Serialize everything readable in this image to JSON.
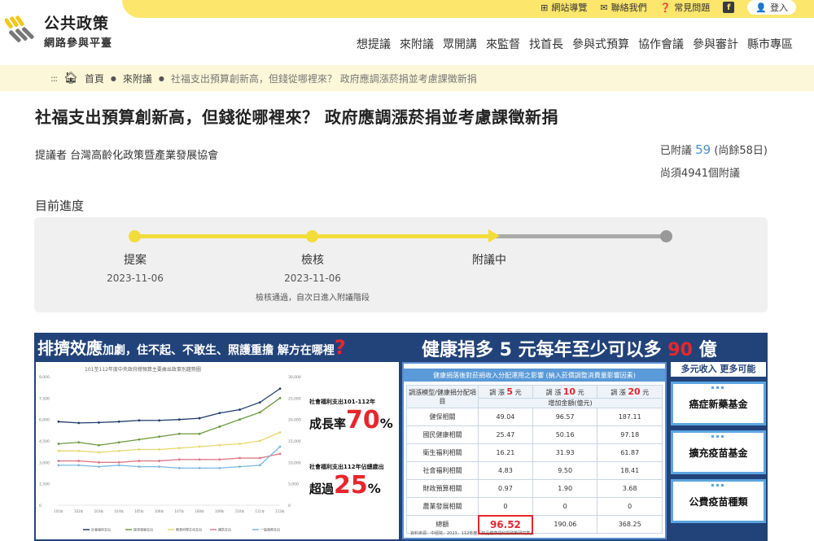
{
  "header": {
    "logo_line1": "公共政策",
    "logo_line2": "網路參與平臺",
    "util": [
      {
        "icon": "sitemap-icon",
        "label": "網站導覽"
      },
      {
        "icon": "mail-icon",
        "label": "聯絡我們"
      },
      {
        "icon": "help-circle-icon",
        "label": "常見問題"
      }
    ],
    "facebook": "f",
    "login": "登入",
    "nav": [
      "想提議",
      "來附議",
      "眾開講",
      "來監督",
      "找首長",
      "參與式預算",
      "協作會議",
      "參與審計",
      "縣市專區"
    ]
  },
  "breadcrumb": {
    "dots": ":::",
    "home": "首頁",
    "section": "來附議",
    "current": "社福支出預算創新高，但錢從哪裡來？ 政府應調漲菸捐並考慮課徵新捐"
  },
  "proposal": {
    "title": "社福支出預算創新高，但錢從哪裡來？ 政府應調漲菸捐並考慮課徵新捐",
    "proposer_label": "提議者",
    "proposer": "台灣高齡化政策暨產業發展協會",
    "seconded_label": "已附議",
    "seconded_count": "59",
    "days_left": "(尚餘58日)",
    "needed": "尚須4941個附議"
  },
  "progress": {
    "label": "目前進度",
    "stages": [
      {
        "name": "提案",
        "date": "2023-11-06",
        "note": ""
      },
      {
        "name": "檢核",
        "date": "2023-11-06",
        "note": "檢核通過，自次日進入附議階段"
      },
      {
        "name": "附議中",
        "date": "",
        "note": ""
      }
    ]
  },
  "banner": {
    "left_title_a": "排擠效應",
    "left_title_b": "加劇",
    "left_title_c": "，住不起、不敢生、照護重擔  解方在哪裡",
    "left_q": "?",
    "right_title_a": "健康捐多 5 元每年至少可以多 ",
    "right_title_num": "90",
    "right_title_b": " 億",
    "chart_title": "101至112年度中央政府總預算主要歲出政事別趨勢圖",
    "stat1_small": "社會福利支出101-112年",
    "stat1_label": "成長率",
    "stat1_value": "70",
    "stat1_unit": "%",
    "stat2_small": "社會福利支出112年佔總歲出",
    "stat2_label": "超過",
    "stat2_value": "25",
    "stat2_unit": "%",
    "table_title": "健康捐落後對菸捐收入分配運用之影響 (納入菸價調整消費量影響因素)",
    "table_head_col1": "調漲模型/健康捐分配項目",
    "table_head_prefix": "調 漲",
    "table_head_vals": [
      "5",
      "10",
      "20"
    ],
    "table_head_suffix": "元",
    "table_subhead": "增加金額(億元)",
    "rows": [
      {
        "label": "健保相關",
        "v": [
          "49.04",
          "96.57",
          "187.11"
        ]
      },
      {
        "label": "國民健康相關",
        "v": [
          "25.47",
          "50.16",
          "97.18"
        ]
      },
      {
        "label": "衛生福利相關",
        "v": [
          "16.21",
          "31.93",
          "61.87"
        ]
      },
      {
        "label": "社會福利相關",
        "v": [
          "4.83",
          "9.50",
          "18.41"
        ]
      },
      {
        "label": "財政預算相關",
        "v": [
          "0.97",
          "1.90",
          "3.68"
        ]
      },
      {
        "label": "農業發展相關",
        "v": [
          "0",
          "0",
          "0"
        ]
      },
      {
        "label": "總額",
        "v": [
          "96.52",
          "190.06",
          "368.25"
        ]
      }
    ],
    "source": "資料來源：中經院，2023，112年度「菸品健康福利捐政策研究案」。",
    "side_head": "多元收入 更多可能",
    "side_items": [
      "癌症新藥基金",
      "擴充疫苗基金",
      "公費疫苗種類"
    ]
  },
  "chart_data": {
    "type": "line",
    "title": "101至112年度中央政府總預算主要歲出政事別趨勢圖",
    "x": [
      "101年",
      "102年",
      "103年",
      "104年",
      "105年",
      "106年",
      "107年",
      "108年",
      "109年",
      "110年",
      "111年",
      "112年"
    ],
    "ylim": [
      0,
      9000
    ],
    "y2lim": [
      0,
      30000
    ],
    "series": [
      {
        "name": "社會福利支出",
        "axis": "right",
        "color": "#1f3d6b",
        "values": [
          19500,
          19200,
          19300,
          19500,
          19800,
          19800,
          20000,
          20300,
          21500,
          22300,
          24000,
          27200
        ]
      },
      {
        "name": "經濟發展支出",
        "axis": "left",
        "color": "#6a9a3a",
        "values": [
          4300,
          4400,
          4200,
          4400,
          4600,
          4800,
          5000,
          5000,
          5500,
          6000,
          6500,
          7500
        ]
      },
      {
        "name": "教育科學文化支出",
        "axis": "left",
        "color": "#e8d86a",
        "values": [
          3800,
          3800,
          3700,
          3800,
          3900,
          3900,
          4000,
          4100,
          4200,
          4300,
          4500,
          5100
        ]
      },
      {
        "name": "國防支出",
        "axis": "left",
        "color": "#e07a8a",
        "values": [
          3100,
          3100,
          3000,
          3000,
          3100,
          3100,
          3200,
          3200,
          3200,
          3300,
          3300,
          3600
        ]
      },
      {
        "name": "一般政務支出",
        "axis": "left",
        "color": "#7ab8e0",
        "values": [
          2800,
          2800,
          2700,
          2800,
          2700,
          2700,
          2600,
          2600,
          2600,
          2700,
          2800,
          4100
        ]
      }
    ],
    "yticks": [
      "0",
      "1,500",
      "3,000",
      "4,500",
      "6,000",
      "7,500",
      "9,000"
    ],
    "y2ticks": [
      "0",
      "5,000",
      "10,000",
      "15,000",
      "20,000",
      "25,000",
      "30,000"
    ],
    "grid": false,
    "legend": "bottom"
  },
  "colors": {
    "brand_yellow": "#fce66b",
    "accent_blue": "#22437a",
    "alert_red": "#e8262c"
  }
}
